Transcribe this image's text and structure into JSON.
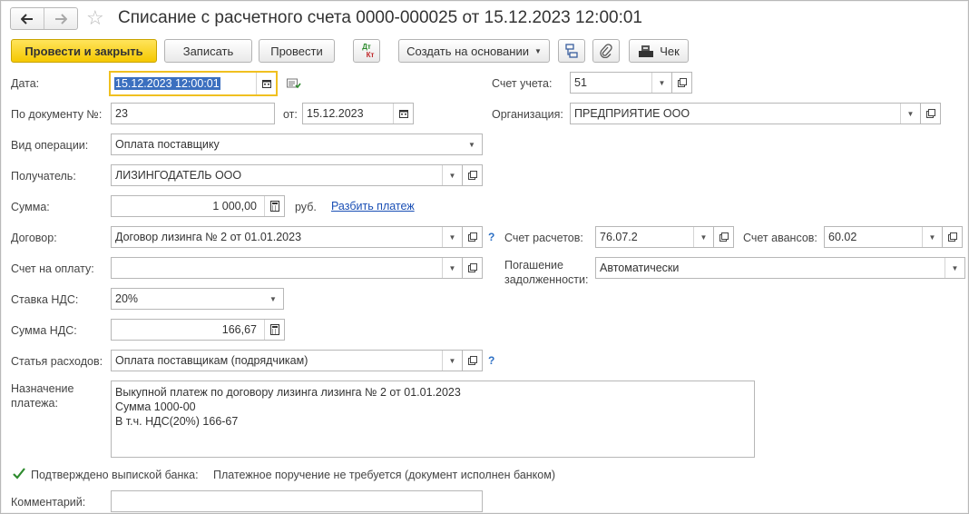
{
  "window": {
    "title": "Списание с расчетного счета 0000-000025 от 15.12.2023 12:00:01",
    "back_icon": "arrow-left-icon",
    "forward_icon": "arrow-right-icon",
    "favorite_icon": "star-icon"
  },
  "toolbar": {
    "post_close": "Провести и закрыть",
    "save": "Записать",
    "post": "Провести",
    "dt_kt_top": "Дт",
    "dt_kt_bottom": "Кт",
    "create_based": "Создать на основании",
    "check": "Чек"
  },
  "form": {
    "date_label": "Дата:",
    "date_value": "15.12.2023 12:00:01",
    "doc_label": "По документу №:",
    "doc_value": "23",
    "from_label": "от:",
    "from_value": "15.12.2023",
    "account_label": "Счет учета:",
    "account_value": "51",
    "org_label": "Организация:",
    "org_value": "ПРЕДПРИЯТИЕ ООО",
    "op_label": "Вид операции:",
    "op_value": "Оплата поставщику",
    "recipient_label": "Получатель:",
    "recipient_value": "ЛИЗИНГОДАТЕЛЬ ООО",
    "sum_label": "Сумма:",
    "sum_value": "1 000,00",
    "currency": "руб.",
    "split_link": "Разбить платеж",
    "contract_label": "Договор:",
    "contract_value": "Договор лизинга № 2 от 01.01.2023",
    "help": "?",
    "settle_label": "Счет расчетов:",
    "settle_value": "76.07.2",
    "advance_label": "Счет авансов:",
    "advance_value": "60.02",
    "invoice_label": "Счет на оплату:",
    "invoice_value": "",
    "repay_label_1": "Погашение",
    "repay_label_2": "задолженности:",
    "repay_value": "Автоматически",
    "vat_rate_label": "Ставка НДС:",
    "vat_rate_value": "20%",
    "vat_sum_label": "Сумма НДС:",
    "vat_sum_value": "166,67",
    "expense_label": "Статья расходов:",
    "expense_value": "Оплата поставщикам (подрядчикам)",
    "purpose_label_1": "Назначение",
    "purpose_label_2": "платежа:",
    "purpose_line1": "Выкупной платеж по договору лизинга лизинга № 2 от 01.01.2023",
    "purpose_line2": "Сумма 1000-00",
    "purpose_line3": "В т.ч. НДС(20%) 166-67",
    "bank_confirm_label": "Подтверждено выпиской банка:",
    "bank_note": "Платежное поручение не требуется (документ исполнен банком)",
    "comment_label": "Комментарий:",
    "comment_value": ""
  },
  "colors": {
    "primary_button": "#f5c800",
    "link": "#1a4fb5",
    "selection": "#3b6fbf",
    "focus_border": "#f0c020",
    "checkbox_check": "#2e8b2e"
  }
}
